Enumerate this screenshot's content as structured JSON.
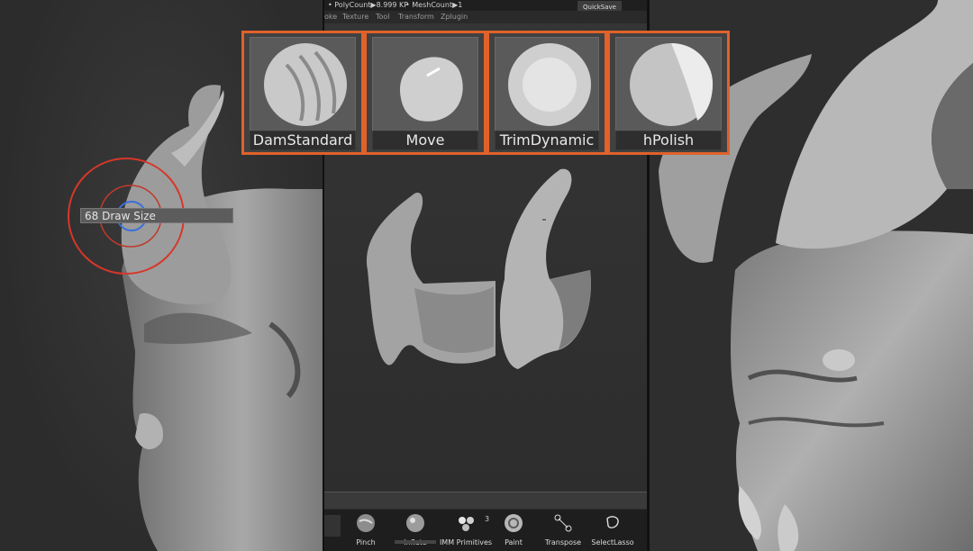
{
  "status_bar": {
    "polycount": "• PolyCount▶8.999 KP",
    "meshcount": "• MeshCount▶1",
    "quicksave": "QuickSave"
  },
  "menu": [
    "oke",
    "Texture",
    "Tool",
    "Transform",
    "Zplugin"
  ],
  "brushes": [
    {
      "label": "DamStandard",
      "icon": "damstandard-brush-icon"
    },
    {
      "label": "Move",
      "icon": "move-brush-icon"
    },
    {
      "label": "TrimDynamic",
      "icon": "trimdynamic-brush-icon"
    },
    {
      "label": "hPolish",
      "icon": "hpolish-brush-icon"
    }
  ],
  "brush_cursor": {
    "readout": "68 Draw Size"
  },
  "shelf": {
    "items": [
      "Pinch",
      "Inflate",
      "IMM Primitives",
      "Paint",
      "Transpose",
      "SelectLasso"
    ],
    "imm_count": "3"
  },
  "colors": {
    "highlight": "#e0622a",
    "brush_ring_outer": "#d7372a",
    "brush_ring_inner": "#3a6fd8"
  }
}
